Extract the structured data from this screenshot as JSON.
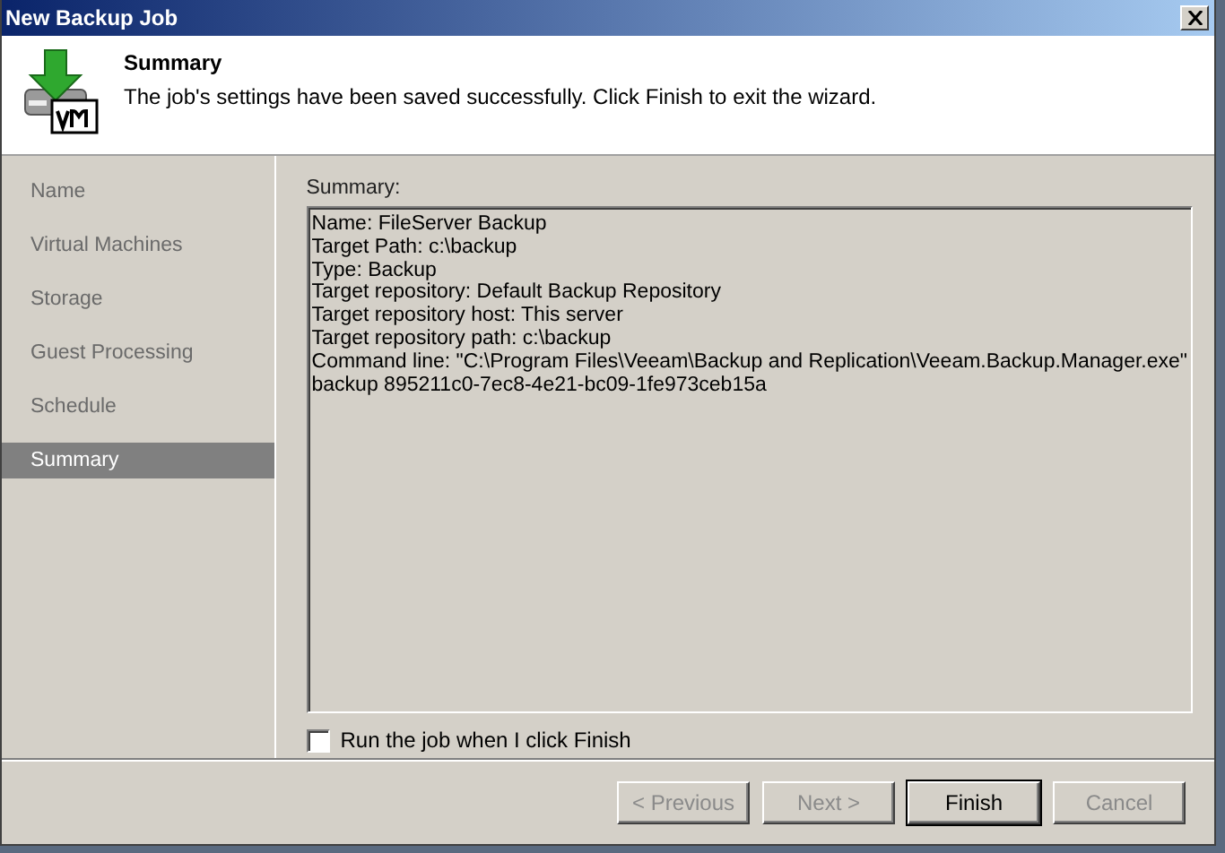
{
  "window": {
    "title": "New Backup Job"
  },
  "header": {
    "title": "Summary",
    "description": "The job's settings have been saved successfully. Click Finish to exit the wizard."
  },
  "sidebar": {
    "items": [
      {
        "label": "Name",
        "selected": false
      },
      {
        "label": "Virtual Machines",
        "selected": false
      },
      {
        "label": "Storage",
        "selected": false
      },
      {
        "label": "Guest Processing",
        "selected": false
      },
      {
        "label": "Schedule",
        "selected": false
      },
      {
        "label": "Summary",
        "selected": true
      }
    ]
  },
  "summary": {
    "label": "Summary:",
    "lines": [
      "Name: FileServer Backup",
      "Target Path: c:\\backup",
      "Type: Backup",
      "Target repository: Default Backup Repository",
      "Target repository host: This server",
      "Target repository path: c:\\backup",
      "Command line: \"C:\\Program Files\\Veeam\\Backup and Replication\\Veeam.Backup.Manager.exe\"",
      "backup 895211c0-7ec8-4e21-bc09-1fe973ceb15a"
    ]
  },
  "run_option": {
    "label": "Run the job when I click Finish",
    "checked": false
  },
  "buttons": [
    {
      "label": "< Previous",
      "disabled": true,
      "default": false
    },
    {
      "label": "Next >",
      "disabled": true,
      "default": false
    },
    {
      "label": "Finish",
      "disabled": false,
      "default": true
    },
    {
      "label": "Cancel",
      "disabled": true,
      "default": false
    }
  ]
}
